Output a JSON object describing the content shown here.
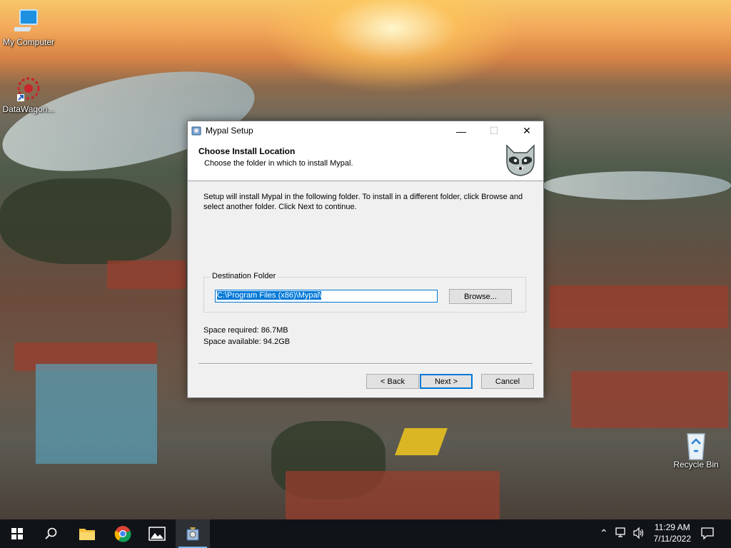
{
  "desktop": {
    "icons": [
      {
        "label": "My Computer",
        "icon": "computer-icon"
      },
      {
        "label": "DataWagon...",
        "icon": "datawagon-icon"
      },
      {
        "label": "Recycle Bin",
        "icon": "recycle-bin-icon"
      }
    ]
  },
  "dialog": {
    "title": "Mypal Setup",
    "header_title": "Choose Install Location",
    "header_subtitle": "Choose the folder in which to install Mypal.",
    "body_text": "Setup will install Mypal in the following folder. To install in a different folder, click Browse and select another folder. Click Next to continue.",
    "group_label": "Destination Folder",
    "destination_value": "C:\\Program Files (x86)\\Mypal\\",
    "browse_label": "Browse...",
    "space_required": "Space required: 86.7MB",
    "space_available": "Space available: 94.2GB",
    "back_label": "< Back",
    "next_label": "Next >",
    "cancel_label": "Cancel"
  },
  "taskbar": {
    "items": [
      "start-icon",
      "search-icon",
      "file-explorer-icon",
      "chrome-icon",
      "photos-icon",
      "installer-icon"
    ],
    "time": "11:29 AM",
    "date": "7/11/2022"
  },
  "colors": {
    "accent": "#0078d7",
    "taskbar": "#101418"
  }
}
